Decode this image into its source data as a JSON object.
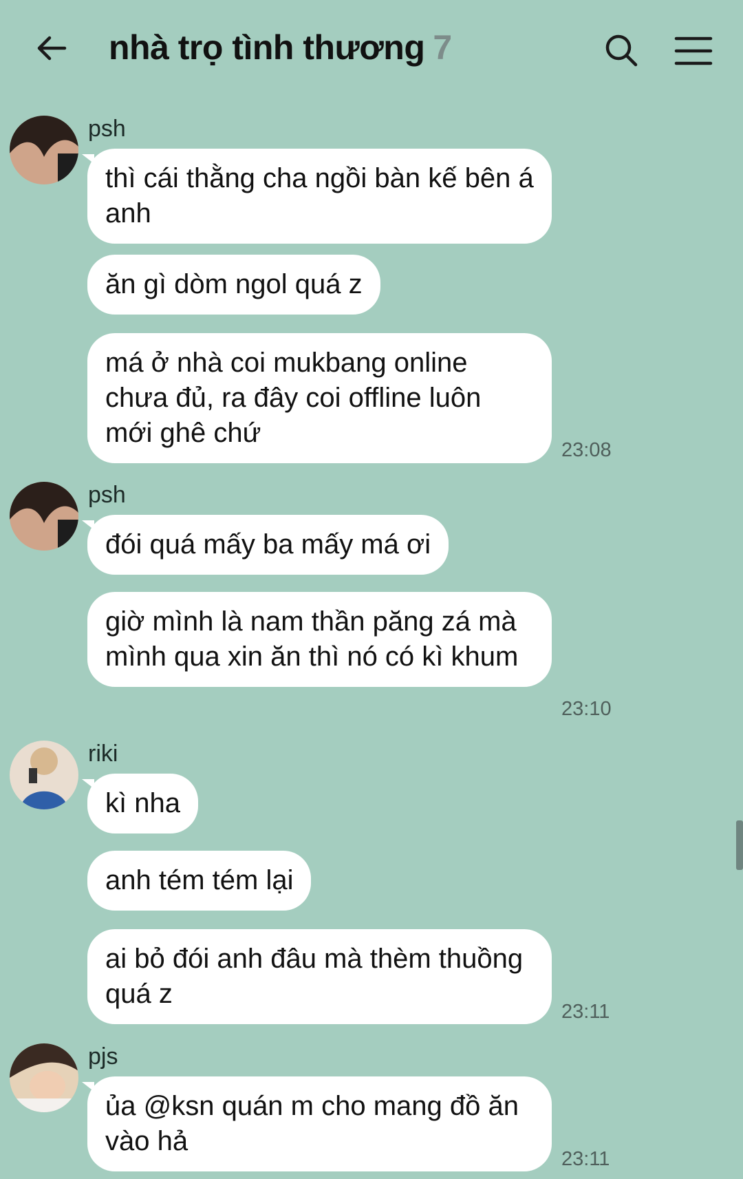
{
  "header": {
    "title": "nhà trọ tình thương",
    "member_count": "7",
    "back_icon": "arrow-left-icon",
    "search_icon": "search-icon",
    "menu_icon": "hamburger-menu-icon"
  },
  "colors": {
    "background": "#a4cdbf",
    "bubble": "#ffffff",
    "timestamp": "#4f5f5b"
  },
  "messages": [
    {
      "sender": "psh",
      "bubbles": [
        "thì cái thằng cha ngồi bàn kế bên á anh",
        "ăn gì dòm ngol quá z",
        "má ở nhà coi mukbang online chưa đủ, ra đây coi offline luôn mới ghê chứ"
      ],
      "time": "23:08"
    },
    {
      "sender": "psh",
      "bubbles": [
        "đói quá mấy ba mấy má ơi",
        "giờ mình là nam thần păng zá mà mình qua xin ăn thì nó có kì khum"
      ],
      "time": "23:10"
    },
    {
      "sender": "riki",
      "bubbles": [
        "kì nha",
        "anh tém tém lại",
        "ai bỏ đói anh đâu mà thèm thuồng quá z"
      ],
      "time": "23:11"
    },
    {
      "sender": "pjs",
      "bubbles": [
        "ủa @ksn quán m cho mang đồ ăn vào hả"
      ],
      "time": "23:11"
    }
  ]
}
